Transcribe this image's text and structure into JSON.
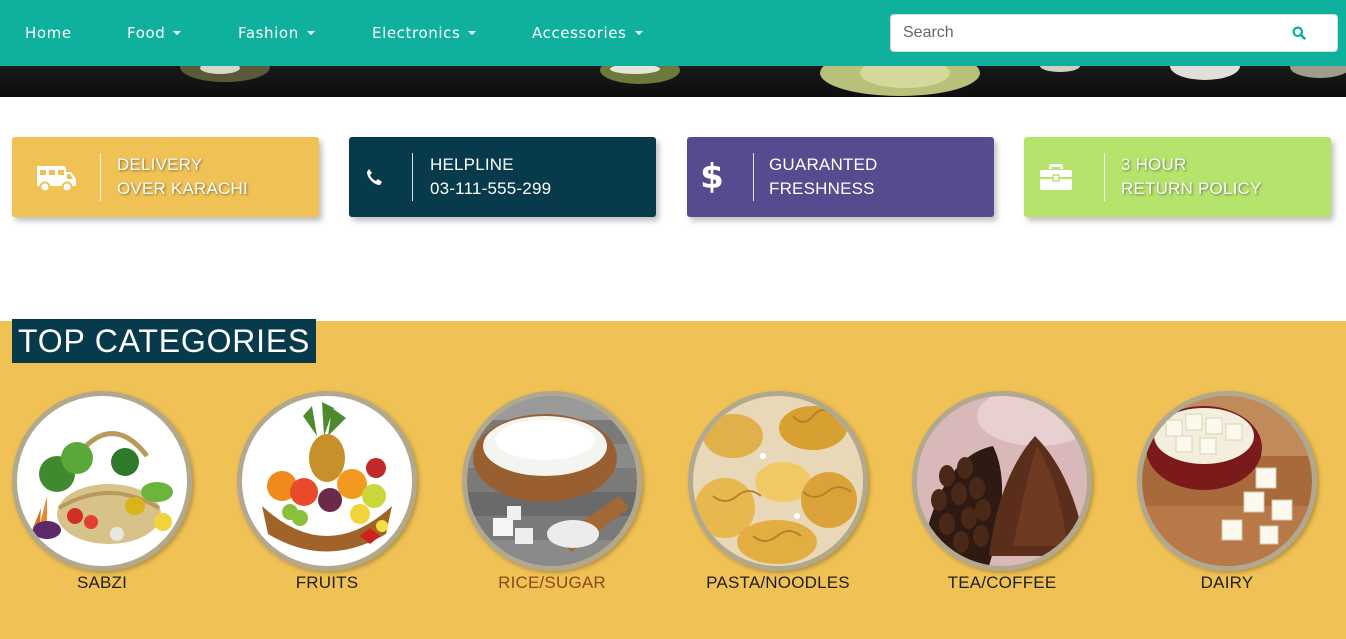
{
  "nav": {
    "items": [
      {
        "label": "Home",
        "dropdown": false
      },
      {
        "label": "Food",
        "dropdown": true
      },
      {
        "label": "Fashion",
        "dropdown": true
      },
      {
        "label": "Electronics",
        "dropdown": true
      },
      {
        "label": "Accessories",
        "dropdown": true
      }
    ],
    "search": {
      "placeholder": "Search",
      "value": "",
      "icon": "search-icon"
    },
    "color": "#10b09e"
  },
  "features": [
    {
      "line1": "DELIVERY",
      "line2": "OVER KARACHI",
      "icon": "truck-icon",
      "color": "#f0c155"
    },
    {
      "line1": "HELPLINE",
      "line2": "03-111-555-299",
      "icon": "phone-icon",
      "color": "#073b4c"
    },
    {
      "line1": "GUARANTED",
      "line2": "FRESHNESS",
      "icon": "dollar-icon",
      "color": "#574a8e"
    },
    {
      "line1": "3 HOUR",
      "line2": "RETURN POLICY",
      "icon": "briefcase-icon",
      "color": "#b5e36c"
    }
  ],
  "categories": {
    "title": "TOP CATEGORIES",
    "items": [
      {
        "label": "SABZI",
        "active": false
      },
      {
        "label": "FRUITS",
        "active": false
      },
      {
        "label": "RICE/SUGAR",
        "active": true
      },
      {
        "label": "PASTA/NOODLES",
        "active": false
      },
      {
        "label": "TEA/COFFEE",
        "active": false
      },
      {
        "label": "DAIRY",
        "active": false
      }
    ],
    "background": "#f0c155"
  }
}
